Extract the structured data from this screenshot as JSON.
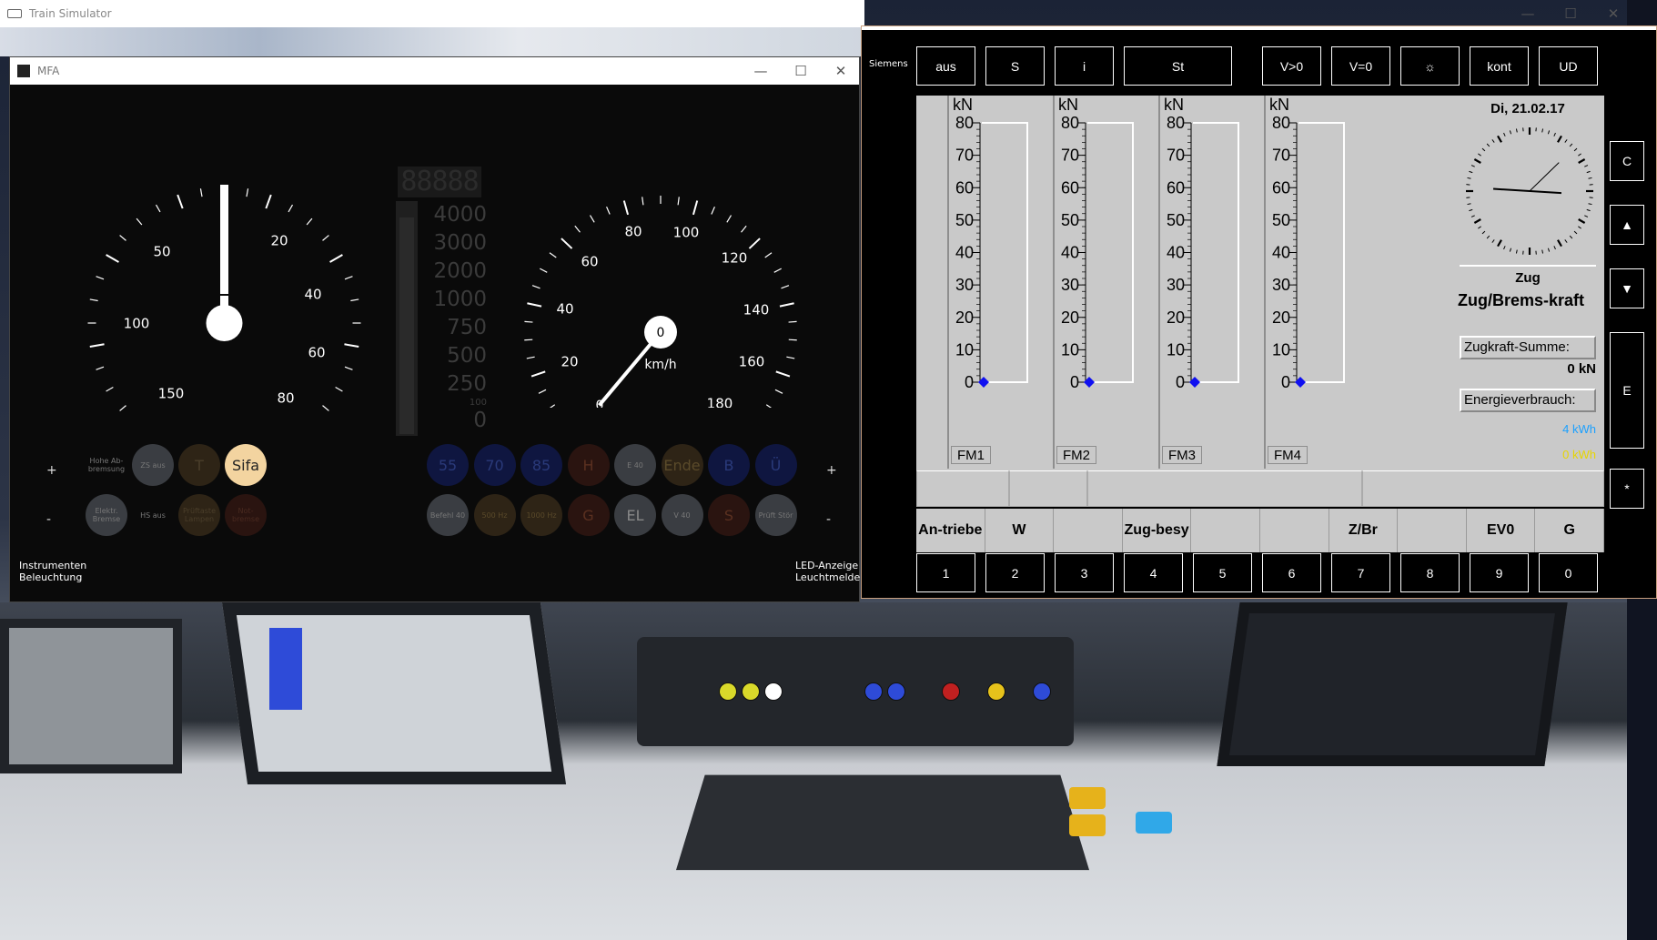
{
  "host": {
    "title": "Train Simulator"
  },
  "mfa": {
    "title": "MFA",
    "controls": {
      "minimize": "—",
      "maximize": "☐",
      "close": "✕"
    },
    "traction_gauge": {
      "labels": [
        "0",
        "20",
        "40",
        "60",
        "80",
        "50",
        "100",
        "150"
      ]
    },
    "speed_gauge": {
      "labels": [
        "0",
        "20",
        "40",
        "60",
        "80",
        "100",
        "120",
        "140",
        "160",
        "180"
      ],
      "readout": "0",
      "unit": "km/h",
      "value": 0
    },
    "bar_meter": {
      "digits": "88888",
      "labels": [
        "4000",
        "3000",
        "2000",
        "1000",
        "750",
        "500",
        "250",
        "0"
      ],
      "small_label": "100"
    },
    "lamps_left_top": [
      {
        "label": "Hohe Ab-bremsung"
      },
      {
        "label": "ZS aus"
      },
      {
        "label": "T"
      },
      {
        "label": "Sifa"
      }
    ],
    "lamps_left_bottom": [
      {
        "label": "Elektr. Bremse"
      },
      {
        "label": "HS aus"
      },
      {
        "label": "Prüftaste Lampen"
      },
      {
        "label": "Not-bremse"
      }
    ],
    "lamps_right_top": [
      {
        "label": "55"
      },
      {
        "label": "70"
      },
      {
        "label": "85"
      },
      {
        "label": "H"
      },
      {
        "label": "E 40"
      },
      {
        "label": "Ende"
      },
      {
        "label": "B"
      },
      {
        "label": "Ü"
      }
    ],
    "lamps_right_bottom": [
      {
        "label": "Befehl 40"
      },
      {
        "label": "500 Hz"
      },
      {
        "label": "1000 Hz"
      },
      {
        "label": "G"
      },
      {
        "label": "EL"
      },
      {
        "label": "V 40"
      },
      {
        "label": "S"
      },
      {
        "label": "Prüft Stör"
      }
    ],
    "plus": "+",
    "minus": "-",
    "footer_left": [
      "Instrumenten",
      "Beleuchtung"
    ],
    "footer_right": [
      "LED-Anzeige",
      "Leuchtmelder"
    ]
  },
  "siemens": {
    "brand": "Siemens",
    "top_buttons": [
      "aus",
      "S",
      "i",
      "St",
      "V>0",
      "V=0",
      "☼",
      "kont",
      "UD"
    ],
    "unit": "kN",
    "scale": [
      "80",
      "70",
      "60",
      "50",
      "40",
      "30",
      "20",
      "10",
      "0"
    ],
    "motors": [
      {
        "name": "FM1",
        "value": 0
      },
      {
        "name": "FM2",
        "value": 0
      },
      {
        "name": "FM3",
        "value": 0
      },
      {
        "name": "FM4",
        "value": 0
      }
    ],
    "date": "Di, 21.02.17",
    "clock": {
      "hours": 9,
      "minutes": 7,
      "seconds": 38
    },
    "mode": "Zug",
    "force_title": "Zug/Brems-kraft",
    "zugkraft_label": "Zugkraft-Summe:",
    "zugkraft_value": "0 kN",
    "energy_label": "Energieverbrauch:",
    "energy_value_1": "4 kWh",
    "energy_value_2": "0 kWh",
    "softkeys": [
      "An-triebe",
      "W",
      "",
      "Zug-besy",
      "",
      "",
      "Z/Br",
      "",
      "EV0",
      "G"
    ],
    "number_buttons": [
      "1",
      "2",
      "3",
      "4",
      "5",
      "6",
      "7",
      "8",
      "9",
      "0"
    ],
    "side_buttons": [
      "C",
      "▲",
      "▼",
      "E",
      "*"
    ],
    "controls": {
      "minimize": "—",
      "maximize": "☐",
      "close": "✕"
    }
  }
}
